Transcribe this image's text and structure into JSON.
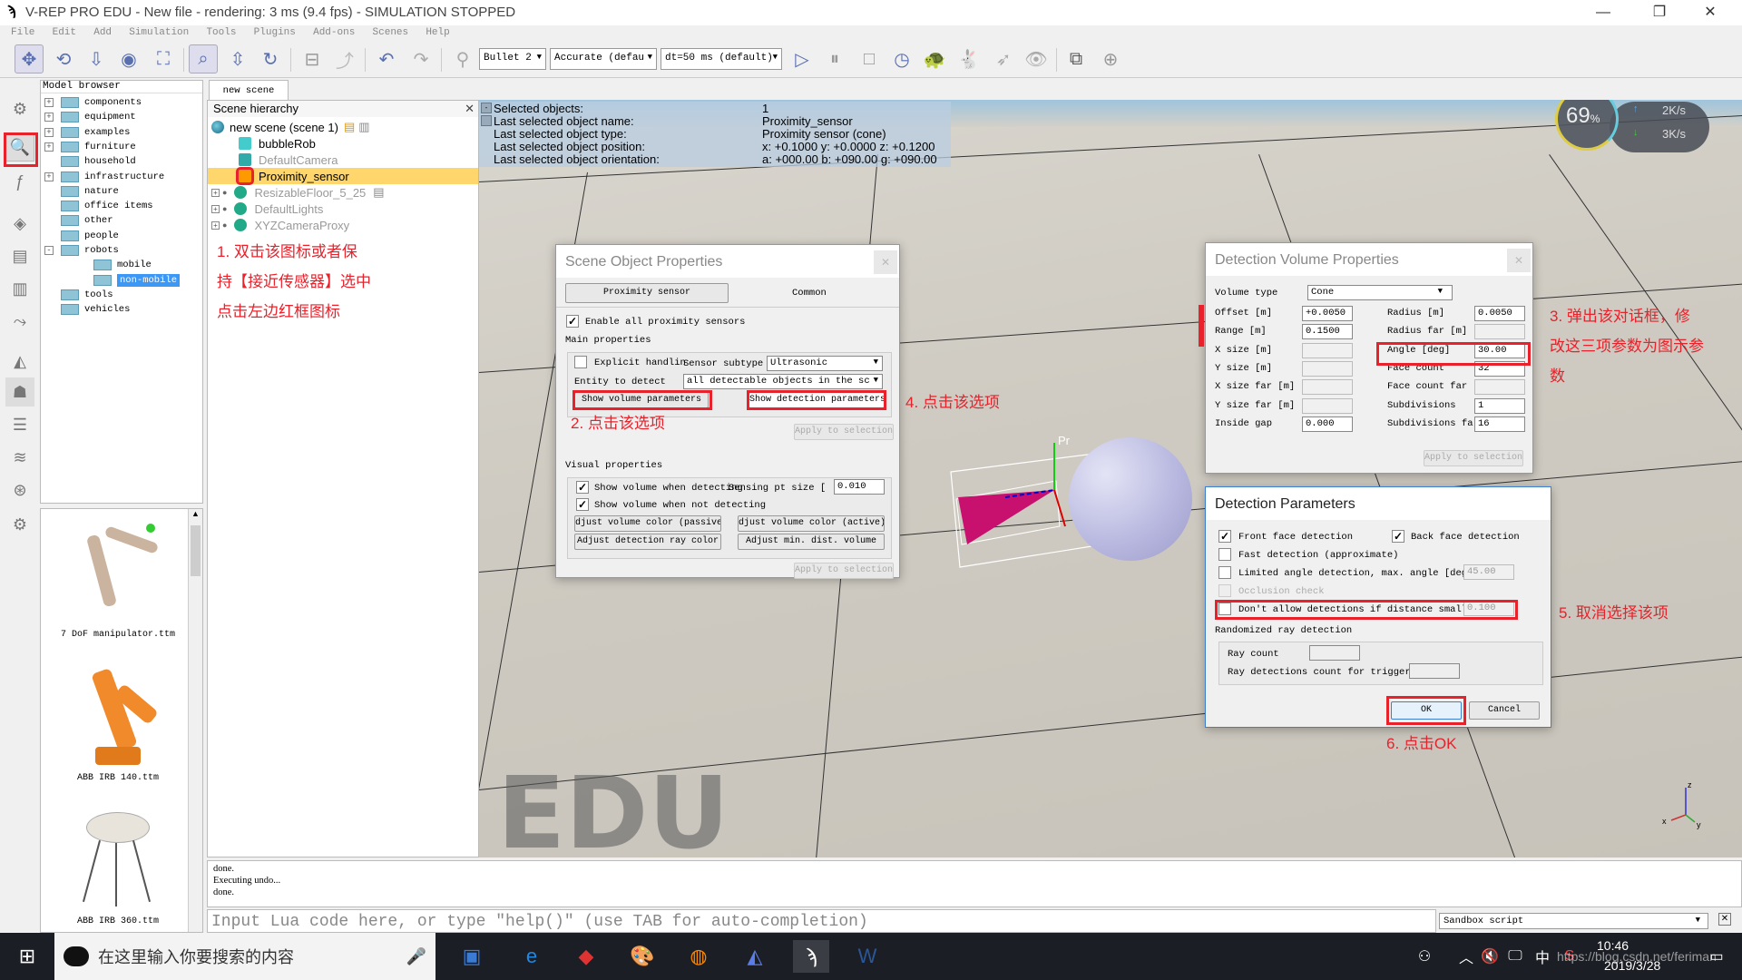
{
  "window": {
    "title": "V-REP PRO EDU - New file - rendering: 3 ms (9.4 fps) - SIMULATION STOPPED",
    "controls": [
      "minimize",
      "restore",
      "close"
    ]
  },
  "menu": [
    "File",
    "Edit",
    "Add",
    "Simulation",
    "Tools",
    "Plugins",
    "Add-ons",
    "Scenes",
    "Help"
  ],
  "toolbar": {
    "engine": "Bullet 2",
    "accuracy": "Accurate (defau",
    "timestep": "dt=50 ms (default)"
  },
  "model_browser": {
    "header": "Model browser",
    "items": [
      {
        "label": "components",
        "expand": "+"
      },
      {
        "label": "equipment",
        "expand": "+"
      },
      {
        "label": "examples",
        "expand": "+"
      },
      {
        "label": "furniture",
        "expand": "+"
      },
      {
        "label": "household",
        "expand": ""
      },
      {
        "label": "infrastructure",
        "expand": "+"
      },
      {
        "label": "nature",
        "expand": ""
      },
      {
        "label": "office items",
        "expand": ""
      },
      {
        "label": "other",
        "expand": ""
      },
      {
        "label": "people",
        "expand": ""
      },
      {
        "label": "robots",
        "expand": "-"
      },
      {
        "label": "mobile",
        "expand": ""
      },
      {
        "label": "non-mobile",
        "expand": "",
        "selected": true
      },
      {
        "label": "tools",
        "expand": ""
      },
      {
        "label": "vehicles",
        "expand": ""
      }
    ],
    "thumbnails": [
      "7 DoF manipulator.ttm",
      "ABB IRB 140.ttm",
      "ABB IRB 360.ttm"
    ]
  },
  "scene_tab": "new scene",
  "hierarchy": {
    "header": "Scene hierarchy",
    "root": "new scene (scene 1)",
    "items": [
      {
        "label": "bubbleRob",
        "dim": false
      },
      {
        "label": "DefaultCamera",
        "dim": true
      },
      {
        "label": "Proximity_sensor",
        "dim": false,
        "selected": true
      },
      {
        "label": "ResizableFloor_5_25",
        "dim": true
      },
      {
        "label": "DefaultLights",
        "dim": true
      },
      {
        "label": "XYZCameraProxy",
        "dim": true
      }
    ]
  },
  "info": {
    "rows": [
      {
        "k": "Selected objects:",
        "v": "1"
      },
      {
        "k": "Last selected object name:",
        "v": "Proximity_sensor"
      },
      {
        "k": "Last selected object type:",
        "v": "Proximity sensor (cone)"
      },
      {
        "k": "Last selected object position:",
        "v": "x: +0.1000   y: +0.0000   z: +0.1200"
      },
      {
        "k": "Last selected object orientation:",
        "v": "a: +000.00   b: +090.00   g: +090.00"
      }
    ]
  },
  "gauge": {
    "percent": "69",
    "unit": "%",
    "up": "2K/s",
    "down": "3K/s"
  },
  "watermark": "EDU",
  "scene_object_props": {
    "title": "Scene Object Properties",
    "tabs": [
      "Proximity sensor",
      "Common"
    ],
    "enable_all": "Enable all proximity sensors",
    "main_props": "Main properties",
    "explicit_handling": "Explicit handlin",
    "sensor_subtype_label": "Sensor subtype",
    "sensor_subtype": "Ultrasonic",
    "entity_label": "Entity to detect",
    "entity_value": "all detectable objects in the sc",
    "show_volume": "Show volume parameters",
    "show_detection": "Show detection parameters",
    "apply": "Apply to selection",
    "visual_props": "Visual properties",
    "show_vol_detecting": "Show volume when detecting",
    "sensing_pt_label": "Sensing pt size [",
    "sensing_pt_value": "0.010",
    "show_vol_not_detecting": "Show volume when not detecting",
    "adj_passive": "djust volume color (passive",
    "adj_active": "djust volume color (active)",
    "adj_ray": "Adjust detection ray color",
    "adj_min": "Adjust min. dist. volume",
    "apply2": "Apply to selection"
  },
  "detection_volume": {
    "title": "Detection Volume Properties",
    "volume_type_label": "Volume type",
    "volume_type": "Cone",
    "left": [
      {
        "label": "Offset [m]",
        "value": "+0.0050",
        "enabled": true
      },
      {
        "label": "Range [m]",
        "value": "0.1500",
        "enabled": true
      },
      {
        "label": "X size [m]",
        "value": "",
        "enabled": false
      },
      {
        "label": "Y size [m]",
        "value": "",
        "enabled": false
      },
      {
        "label": "X size far [m]",
        "value": "",
        "enabled": false
      },
      {
        "label": "Y size far [m]",
        "value": "",
        "enabled": false
      },
      {
        "label": "Inside gap",
        "value": "0.000",
        "enabled": true
      }
    ],
    "right": [
      {
        "label": "Radius [m]",
        "value": "0.0050",
        "enabled": true
      },
      {
        "label": "Radius far [m]",
        "value": "",
        "enabled": false
      },
      {
        "label": "Angle [deg]",
        "value": "30.00",
        "enabled": true
      },
      {
        "label": "Face count",
        "value": "32",
        "enabled": true
      },
      {
        "label": "Face count far",
        "value": "",
        "enabled": false
      },
      {
        "label": "Subdivisions",
        "value": "1",
        "enabled": true
      },
      {
        "label": "Subdivisions fa",
        "value": "16",
        "enabled": true
      }
    ],
    "apply": "Apply to selection"
  },
  "detection_params": {
    "title": "Detection Parameters",
    "front_face": "Front face detection",
    "back_face": "Back face detection",
    "fast": "Fast detection (approximate)",
    "limited_angle": "Limited angle detection, max. angle [deg]",
    "limited_angle_value": "45.00",
    "occlusion": "Occlusion check",
    "min_dist": "Don't allow detections if distance smalle",
    "min_dist_value": "0.100",
    "randomized": "Randomized ray detection",
    "ray_count": "Ray count",
    "ray_trigger": "Ray detections count for triggeri",
    "ok": "OK",
    "cancel": "Cancel"
  },
  "annotations": {
    "n1": [
      "1.  双击该图标或者保",
      "持【接近传感器】选中",
      "点击左边红框图标"
    ],
    "n2": "2.  点击该选项",
    "n3": [
      "3.  弹出该对话框，修",
      "改这三项参数为图示参",
      "数"
    ],
    "n4": "4.  点击该选项",
    "n5": "5.  取消选择该项",
    "n6": "6. 点击OK"
  },
  "console": {
    "lines": [
      "done.",
      "Executing undo...",
      "done."
    ],
    "input_placeholder": "Input Lua code here, or type \"help()\" (use TAB for auto-completion)",
    "script_type": "Sandbox script"
  },
  "taskbar": {
    "search_placeholder": "在这里输入你要搜索的内容",
    "time": "10:46",
    "date": "2019/3/28",
    "ime": "中",
    "watermark": "https://blog.csdn.net/feriman"
  }
}
